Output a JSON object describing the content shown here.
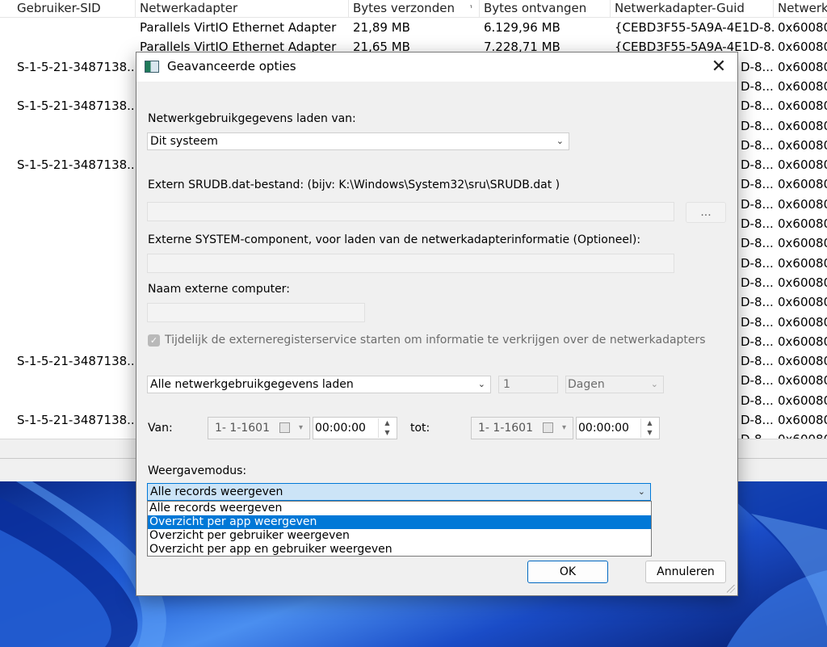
{
  "table": {
    "columns": [
      "Gebruiker-SID",
      "Netwerkadapter",
      "Bytes verzonden",
      "Bytes ontvangen",
      "Netwerkadapter-Guid",
      "Netwerk"
    ],
    "rows": [
      [
        "",
        "Parallels VirtIO Ethernet Adapter",
        "21,89 MB",
        "6.129,96 MB",
        "{CEBD3F55-5A9A-4E1D-8...",
        "0x60080"
      ],
      [
        "",
        "Parallels VirtIO Ethernet Adapter",
        "21,65 MB",
        "7.228,71 MB",
        "{CEBD3F55-5A9A-4E1D-8...",
        "0x60080"
      ],
      [
        "S-1-5-21-3487138...",
        "",
        "",
        "",
        "D-8...",
        "0x60080"
      ],
      [
        "",
        "",
        "",
        "",
        "D-8...",
        "0x60080"
      ],
      [
        "S-1-5-21-3487138...",
        "",
        "",
        "",
        "D-8...",
        "0x60080"
      ],
      [
        "",
        "",
        "",
        "",
        "D-8...",
        "0x60080"
      ],
      [
        "",
        "",
        "",
        "",
        "D-8...",
        "0x60080"
      ],
      [
        "S-1-5-21-3487138...",
        "",
        "",
        "",
        "D-8...",
        "0x60080"
      ],
      [
        "",
        "",
        "",
        "",
        "D-8...",
        "0x60080"
      ],
      [
        "",
        "",
        "",
        "",
        "D-8...",
        "0x60080"
      ],
      [
        "",
        "",
        "",
        "",
        "D-8...",
        "0x60080"
      ],
      [
        "",
        "",
        "",
        "",
        "D-8...",
        "0x60080"
      ],
      [
        "",
        "",
        "",
        "",
        "D-8...",
        "0x60080"
      ],
      [
        "",
        "",
        "",
        "",
        "D-8...",
        "0x60080"
      ],
      [
        "",
        "",
        "",
        "",
        "D-8...",
        "0x60080"
      ],
      [
        "",
        "",
        "",
        "",
        "D-8...",
        "0x60080"
      ],
      [
        "",
        "",
        "",
        "",
        "D-8...",
        "0x60080"
      ],
      [
        "S-1-5-21-3487138...",
        "",
        "",
        "",
        "D-8...",
        "0x60080"
      ],
      [
        "",
        "",
        "",
        "",
        "D-8...",
        "0x60080"
      ],
      [
        "",
        "",
        "",
        "",
        "D-8...",
        "0x60080"
      ],
      [
        "S-1-5-21-3487138...",
        "",
        "",
        "",
        "D-8...",
        "0x60080"
      ],
      [
        "",
        "",
        "",
        "",
        "D-8...",
        "0x60080"
      ]
    ]
  },
  "dialog": {
    "title": "Geavanceerde opties",
    "load_from_label": "Netwerkgebruikgegevens laden van:",
    "load_from_value": "Dit systeem",
    "srudb_label": "Extern SRUDB.dat-bestand: (bijv: K:\\Windows\\System32\\sru\\SRUDB.dat )",
    "browse_label": "...",
    "system_label": "Externe SYSTEM-component, voor laden van de netwerkadapterinformatie (Optioneel):",
    "computer_label": "Naam externe computer:",
    "checkbox_label": "Tijdelijk de externeregisterservice starten om informatie te verkrijgen over de netwerkadapters",
    "range_value": "Alle netwerkgebruikgegevens laden",
    "count_value": "1",
    "unit_value": "Dagen",
    "from_label": "Van:",
    "from_date": "1-  1-1601",
    "from_time": "00:00:00",
    "to_label": "tot:",
    "to_date": "1-  1-1601",
    "to_time": "00:00:00",
    "view_mode_label": "Weergavemodus:",
    "view_mode_value": "Alle records weergeven",
    "view_mode_options": [
      "Alle records weergeven",
      "Overzicht per app weergeven",
      "Overzicht per gebruiker weergeven",
      "Overzicht per app en gebruiker weergeven"
    ],
    "ok_label": "OK",
    "cancel_label": "Annuleren"
  }
}
